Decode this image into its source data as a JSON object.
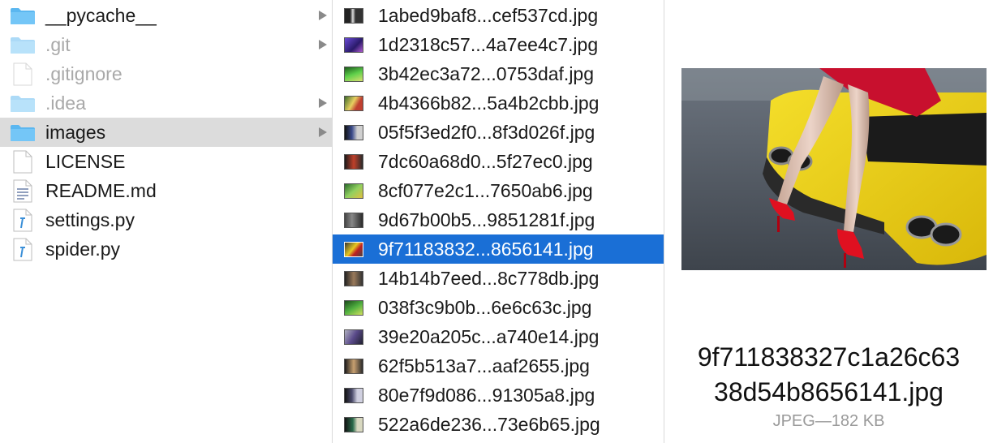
{
  "sidebar": {
    "items": [
      {
        "label": "__pycache__",
        "type": "folder"
      },
      {
        "label": ".git",
        "type": "folder",
        "dim": true
      },
      {
        "label": ".gitignore",
        "type": "file",
        "dim": true
      },
      {
        "label": ".idea",
        "type": "folder",
        "dim": true
      },
      {
        "label": "images",
        "type": "folder",
        "selected": true
      },
      {
        "label": "LICENSE",
        "type": "file"
      },
      {
        "label": "README.md",
        "type": "file-text"
      },
      {
        "label": "settings.py",
        "type": "file-python"
      },
      {
        "label": "spider.py",
        "type": "file-python"
      }
    ]
  },
  "files": {
    "items": [
      "1abed9baf8...cef537cd.jpg",
      "1d2318c57...4a7ee4c7.jpg",
      "3b42ec3a72...0753daf.jpg",
      "4b4366b82...5a4b2cbb.jpg",
      "05f5f3ed2f0...8f3d026f.jpg",
      "7dc60a68d0...5f27ec0.jpg",
      "8cf077e2c1...7650ab6.jpg",
      "9d67b00b5...9851281f.jpg",
      "9f71183832...8656141.jpg",
      "14b14b7eed...8c778db.jpg",
      "038f3c9b0b...6e6c63c.jpg",
      "39e20a205c...a740e14.jpg",
      "62f5b513a7...aaf2655.jpg",
      "80e7f9d086...91305a8.jpg",
      "522a6de236...73e6b65.jpg"
    ],
    "selected_index": 8
  },
  "preview": {
    "filename_line1": "9f711838327c1a26c63",
    "filename_line2": "38d54b8656141.jpg",
    "kind": "JPEG",
    "separator": " — ",
    "size": "182 KB"
  },
  "colors": {
    "selection": "#1a6fd6",
    "folder": "#5bb7f0",
    "sidebar_selection": "#dcdcdc"
  }
}
